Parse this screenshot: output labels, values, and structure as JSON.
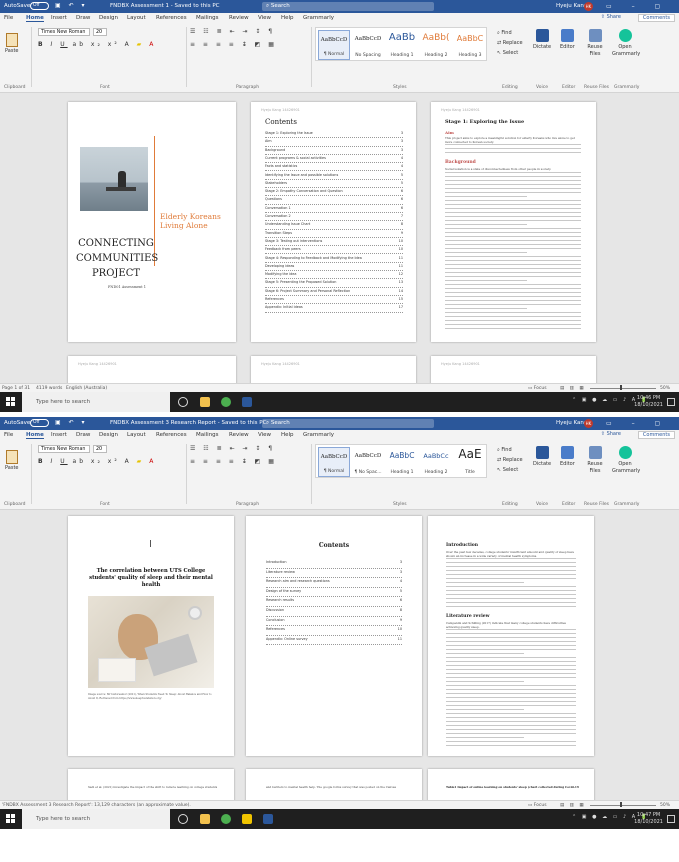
{
  "shot1": {
    "titlebar": {
      "autosave": "AutoSave",
      "toggle": "Off",
      "doc_title": "FNDBX Assessment 1 - Saved to this PC",
      "search": "Search",
      "user": "Hyeju Kang",
      "avatar": "HK"
    },
    "menu": [
      "File",
      "Home",
      "Insert",
      "Draw",
      "Design",
      "Layout",
      "References",
      "Mailings",
      "Review",
      "View",
      "Help",
      "Grammarly"
    ],
    "share": "Share",
    "comments": "Comments",
    "ribbon": {
      "paste": "Paste",
      "font_name": "Times New Roman",
      "font_size": "20",
      "styles": [
        {
          "preview": "AaBbCcD",
          "name": "¶ Normal"
        },
        {
          "preview": "AaBbCcD",
          "name": "No Spacing"
        },
        {
          "preview": "AaBb",
          "name": "Heading 1"
        },
        {
          "preview": "AaBb(",
          "name": "Heading 2"
        },
        {
          "preview": "AaBbC",
          "name": "Heading 3"
        }
      ],
      "editing": [
        "Find",
        "Replace",
        "Select"
      ],
      "big_buttons": [
        "Dictate",
        "Editor",
        "Reuse Files",
        "Open Grammarly"
      ],
      "groups": [
        "Clipboard",
        "Font",
        "Paragraph",
        "Styles",
        "Editing",
        "Voice",
        "Editor",
        "Reuse Files",
        "Grammarly"
      ]
    },
    "cover": {
      "title_lines": [
        "Elderly Koreans",
        "Living Alone"
      ],
      "project_lines": [
        "CONNECTING",
        "COMMUNITIES",
        "PROJECT"
      ],
      "subtitle": "FND01 Assessment 1"
    },
    "toc": {
      "heading": "Contents",
      "rows": [
        {
          "label": "Stage 1: Exploring the Issue",
          "page": "3"
        },
        {
          "label": "Aim",
          "page": "3"
        },
        {
          "label": "Background",
          "page": "3"
        },
        {
          "label": "Current programs & social activities",
          "page": "4"
        },
        {
          "label": "Facts and statistics",
          "page": "4"
        },
        {
          "label": "Identifying the Issue and possible solutions",
          "page": "5"
        },
        {
          "label": "Stakeholders",
          "page": "5"
        },
        {
          "label": "Stage 2: Empathy Conversation and Question",
          "page": "6"
        },
        {
          "label": "Questions",
          "page": "6"
        },
        {
          "label": "Conversation 1",
          "page": "6"
        },
        {
          "label": "Conversation 2",
          "page": "7"
        },
        {
          "label": "Understanding Issue Chart",
          "page": "8"
        },
        {
          "label": "Transition Steps",
          "page": "9"
        },
        {
          "label": "Stage 3: Testing out interventions",
          "page": "10"
        },
        {
          "label": "Feedback from peers",
          "page": "10"
        },
        {
          "label": "Stage 4: Responding to Feedback and Modifying the Idea",
          "page": "11"
        },
        {
          "label": "Developing ideas",
          "page": "11"
        },
        {
          "label": "Modifying the idea",
          "page": "12"
        },
        {
          "label": "Stage 5: Presenting the Proposed Solution",
          "page": "13"
        },
        {
          "label": "Stage 6: Project Summary and Personal Reflection",
          "page": "14"
        },
        {
          "label": "References",
          "page": "15"
        },
        {
          "label": "Appendix: Initial ideas",
          "page": "17"
        }
      ]
    },
    "stage1": {
      "heading": "Stage 1: Exploring the Issue",
      "aim_heading": "Aim",
      "aim_text": "This project aims to explore a meaningful solution for elderly Koreans who live alone to get more connected to Korean society.",
      "background_heading": "Background",
      "background_text": "Social isolation is a state of disconnectedness from other people in society."
    },
    "header_text": "Hyeju Kang 14426901",
    "status": {
      "page": "Page 1 of 31",
      "words": "4119 words",
      "lang": "English (Australia)",
      "focus": "Focus",
      "zoom": "50%"
    },
    "taskbar": {
      "search": "Type here to search",
      "time": "10:46 PM",
      "date": "18/10/2021"
    }
  },
  "shot2": {
    "titlebar": {
      "autosave": "AutoSave",
      "toggle": "Off",
      "doc_title": "FNDBX Assessment 3 Research Report - Saved to this PC",
      "search": "Search",
      "user": "Hyeju Kang",
      "avatar": "HK"
    },
    "menu": [
      "File",
      "Home",
      "Insert",
      "Draw",
      "Design",
      "Layout",
      "References",
      "Mailings",
      "Review",
      "View",
      "Help",
      "Grammarly"
    ],
    "share": "Share",
    "comments": "Comments",
    "ribbon": {
      "paste": "Paste",
      "font_name": "Times New Roman",
      "font_size": "20",
      "styles": [
        {
          "preview": "AaBbCcD",
          "name": "¶ Normal"
        },
        {
          "preview": "AaBbCcD",
          "name": "¶ No Spac..."
        },
        {
          "preview": "AaBbC",
          "name": "Heading 1"
        },
        {
          "preview": "AaBbCc",
          "name": "Heading 2"
        },
        {
          "preview": "AaE",
          "name": "Title"
        }
      ],
      "editing": [
        "Find",
        "Replace",
        "Select"
      ],
      "big_buttons": [
        "Dictate",
        "Editor",
        "Reuse Files",
        "Open Grammarly"
      ],
      "groups": [
        "Clipboard",
        "Font",
        "Paragraph",
        "Styles",
        "Editing",
        "Voice",
        "Editor",
        "Reuse Files",
        "Grammarly"
      ]
    },
    "cover": {
      "title": "The correlation between UTS College students' quality of sleep and their mental health",
      "caption": "Image source: Mr Isidoreamor (2021), When Students Need To Sleep: About Balance and How to Avoid It, Retrieved from https://www.sleepfoundation.org/"
    },
    "toc": {
      "heading": "Contents",
      "rows": [
        {
          "label": "Introduction",
          "page": "3"
        },
        {
          "label": "Literature review",
          "page": "3"
        },
        {
          "label": "Research aim and research questions",
          "page": "4"
        },
        {
          "label": "Design of the survey",
          "page": "5"
        },
        {
          "label": "Research results",
          "page": "6"
        },
        {
          "label": "Discussion",
          "page": "8"
        },
        {
          "label": "Conclusion",
          "page": "9"
        },
        {
          "label": "References",
          "page": "10"
        },
        {
          "label": "Appendix: Online survey",
          "page": "11"
        }
      ]
    },
    "intro": {
      "heading": "Introduction",
      "text": "Over the past few decades, college students' insufficient amount and quality of sleep have shown an increase in a wide variety of mental health symptoms.",
      "lit_heading": "Literature review",
      "lit_text": "Campanini and Schilling (2017) indicate that many college students have difficulties achieving quality sleep."
    },
    "bottom_texts": [
      "Sadi et al. (2021) investigate the impact of the shift to remote learning on college students",
      "and barriers to mental health help. The google forms survey that was posted on the Canvas",
      "Table1 Impact of online learning on students' sleep (chart collected during Covid-19"
    ],
    "status": {
      "page": "'FNDBX Assessment 3 Research Report': 13,129 characters (an approximate value).",
      "focus": "Focus",
      "zoom": "50%"
    },
    "taskbar": {
      "search": "Type here to search",
      "time": "10:47 PM",
      "date": "18/10/2021"
    }
  },
  "colors": {
    "word_blue": "#2b579a",
    "cover_orange": "#e07b39",
    "heading_orange": "#c0504d",
    "taskbar": "#1f1f1f"
  }
}
